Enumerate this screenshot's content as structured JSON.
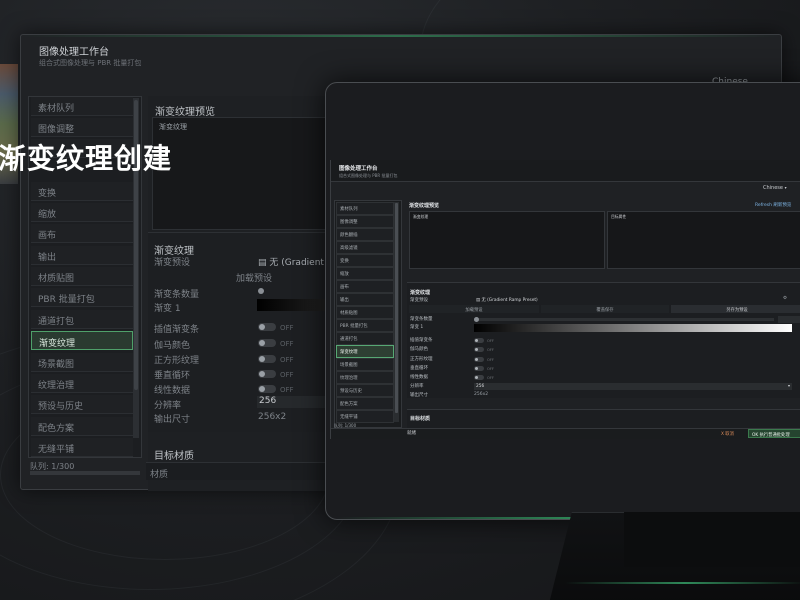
{
  "overlay": {
    "headline": "渐变纹理创建"
  },
  "back_window": {
    "title": "图像处理工作台",
    "subtitle": "组合式图像处理与 PBR 批量打包",
    "language": "Chinese",
    "sidebar": [
      "素材队列",
      "图像调整",
      "",
      "变换",
      "缩放",
      "画布",
      "输出",
      "材质贴图",
      "PBR 批量打包",
      "通道打包",
      "渐变纹理",
      "场景截图",
      "纹理治理",
      "预设与历史",
      "配色方案",
      "无缝平铺"
    ],
    "active_index": 10,
    "queue": "队列: 1/300",
    "preview_title": "渐变纹理预览",
    "preview_label": "渐变纹理",
    "section_title": "渐变纹理",
    "preset_label": "渐变预设",
    "preset_value": "无 (Gradient R",
    "load_preset": "加载预设",
    "stop_count": "渐变条数量",
    "stop_1": "渐变 1",
    "interp": "插值渐变条",
    "gamma": "伽马颜色",
    "square": "正方形纹理",
    "vloop": "垂直循环",
    "linear": "线性数据",
    "resolution_label": "分辨率",
    "resolution_value": "256",
    "output_size_label": "输出尺寸",
    "output_size_value": "256x2",
    "off": "OFF",
    "target_title": "目标材质",
    "material_label": "材质"
  },
  "app": {
    "title": "图像处理工作台",
    "subtitle": "组合式图像处理与 PBR 批量打包",
    "language": "Chinese",
    "sidebar": [
      "素材队列",
      "图像调整",
      "颜色翻插",
      "高级滤镜",
      "变换",
      "缩放",
      "画布",
      "输出",
      "材质贴图",
      "PBR 批量打包",
      "通道打包",
      "渐变纹理",
      "场景截图",
      "纹理治理",
      "预设与历史",
      "配色方案",
      "无缝平铺"
    ],
    "active_index": 11,
    "queue": "队列: 1/300",
    "preview_title": "渐变纹理预览",
    "refresh_label": "Refresh 刷新预览",
    "preview_left_label": "渐变纹理",
    "preview_right_label": "目标属性",
    "section_title": "渐变纹理",
    "preset_label": "渐变预设",
    "preset_value": "无 (Gradient Ramp Preset)",
    "btn_load": "加载预设",
    "btn_overwrite": "覆盖保存",
    "btn_save_as": "另存为预设",
    "stop_count_label": "渐变条数量",
    "stop_count_value": "1",
    "stop_count_fraction": 0.0,
    "stop_1_label": "渐变 1",
    "interp": "插值渐变条",
    "gamma": "伽马颜色",
    "square": "正方形纹理",
    "vloop": "垂直循环",
    "linear": "线性数据",
    "off": "OFF",
    "resolution_label": "分辨率",
    "resolution_value": "256",
    "output_size_label": "输出尺寸",
    "output_size_value": "256x2",
    "target_title": "目标材质",
    "ready": "就绪",
    "cancel": "X 取消",
    "run": "OK 执行普通批处理"
  },
  "colors": {
    "accent": "#4fa06a",
    "background": "#1f2124",
    "run_button": "#25442f"
  }
}
